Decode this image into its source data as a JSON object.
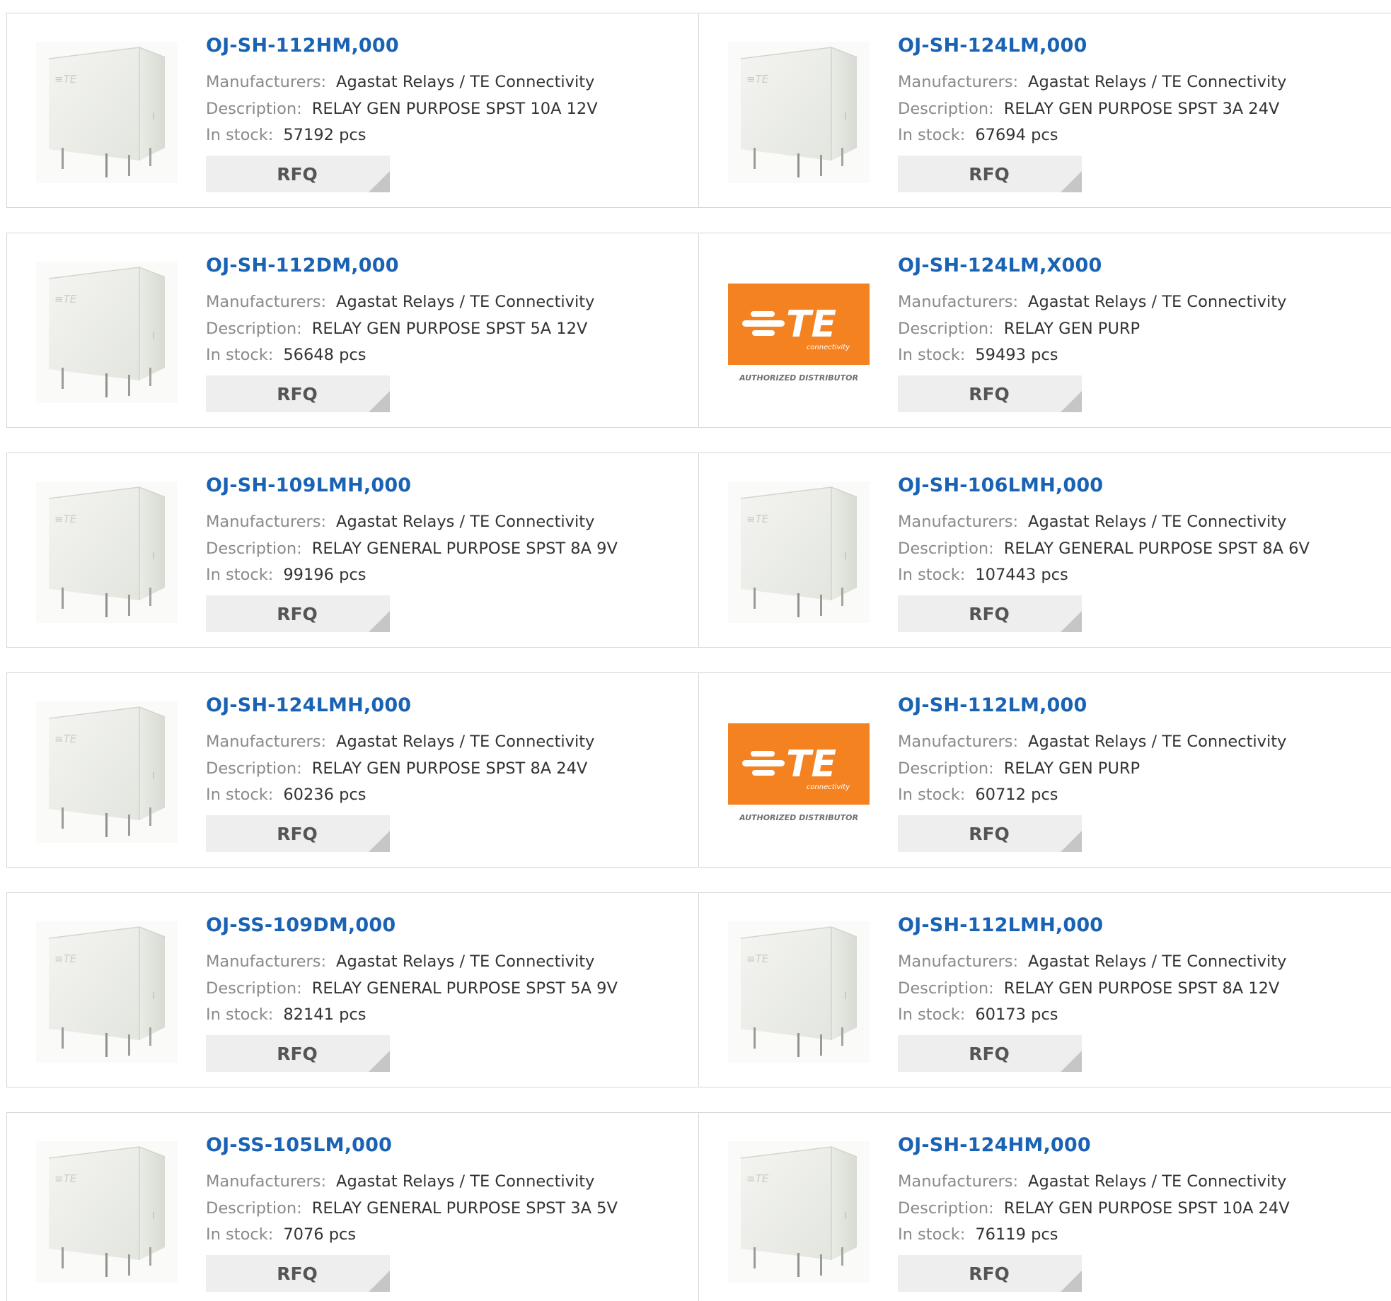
{
  "labels": {
    "manufacturers": "Manufacturers:",
    "description": "Description:",
    "in_stock": "In stock:",
    "rfq": "RFQ"
  },
  "logo": {
    "brand": "TE",
    "tagline": "connectivity",
    "caption": "AUTHORIZED DISTRIBUTOR",
    "color": "#f58220"
  },
  "colors": {
    "part_link": "#1a63b4",
    "label": "#8a8a8a",
    "button_bg": "#eeeeee"
  },
  "products": [
    {
      "part": "OJ-SH-112HM,000",
      "manufacturer": "Agastat Relays / TE Connectivity",
      "description": "RELAY GEN PURPOSE SPST 10A 12V",
      "stock": "57192 pcs",
      "image": "relay-photo"
    },
    {
      "part": "OJ-SH-124LM,000",
      "manufacturer": "Agastat Relays / TE Connectivity",
      "description": "RELAY GEN PURPOSE SPST 3A 24V",
      "stock": "67694 pcs",
      "image": "relay-photo"
    },
    {
      "part": "OJ-SH-112DM,000",
      "manufacturer": "Agastat Relays / TE Connectivity",
      "description": "RELAY GEN PURPOSE SPST 5A 12V",
      "stock": "56648 pcs",
      "image": "relay-photo"
    },
    {
      "part": "OJ-SH-124LM,X000",
      "manufacturer": "Agastat Relays / TE Connectivity",
      "description": "RELAY GEN PURP",
      "stock": "59493 pcs",
      "image": "te-logo"
    },
    {
      "part": "OJ-SH-109LMH,000",
      "manufacturer": "Agastat Relays / TE Connectivity",
      "description": "RELAY GENERAL PURPOSE SPST 8A 9V",
      "stock": "99196 pcs",
      "image": "relay-photo"
    },
    {
      "part": "OJ-SH-106LMH,000",
      "manufacturer": "Agastat Relays / TE Connectivity",
      "description": "RELAY GENERAL PURPOSE SPST 8A 6V",
      "stock": "107443 pcs",
      "image": "relay-photo"
    },
    {
      "part": "OJ-SH-124LMH,000",
      "manufacturer": "Agastat Relays / TE Connectivity",
      "description": "RELAY GEN PURPOSE SPST 8A 24V",
      "stock": "60236 pcs",
      "image": "relay-photo"
    },
    {
      "part": "OJ-SH-112LM,000",
      "manufacturer": "Agastat Relays / TE Connectivity",
      "description": "RELAY GEN PURP",
      "stock": "60712 pcs",
      "image": "te-logo"
    },
    {
      "part": "OJ-SS-109DM,000",
      "manufacturer": "Agastat Relays / TE Connectivity",
      "description": "RELAY GENERAL PURPOSE SPST 5A 9V",
      "stock": "82141 pcs",
      "image": "relay-photo"
    },
    {
      "part": "OJ-SH-112LMH,000",
      "manufacturer": "Agastat Relays / TE Connectivity",
      "description": "RELAY GEN PURPOSE SPST 8A 12V",
      "stock": "60173 pcs",
      "image": "relay-photo"
    },
    {
      "part": "OJ-SS-105LM,000",
      "manufacturer": "Agastat Relays / TE Connectivity",
      "description": "RELAY GENERAL PURPOSE SPST 3A 5V",
      "stock": "7076 pcs",
      "image": "relay-photo"
    },
    {
      "part": "OJ-SH-124HM,000",
      "manufacturer": "Agastat Relays / TE Connectivity",
      "description": "RELAY GEN PURPOSE SPST 10A 24V",
      "stock": "76119 pcs",
      "image": "relay-photo"
    }
  ]
}
